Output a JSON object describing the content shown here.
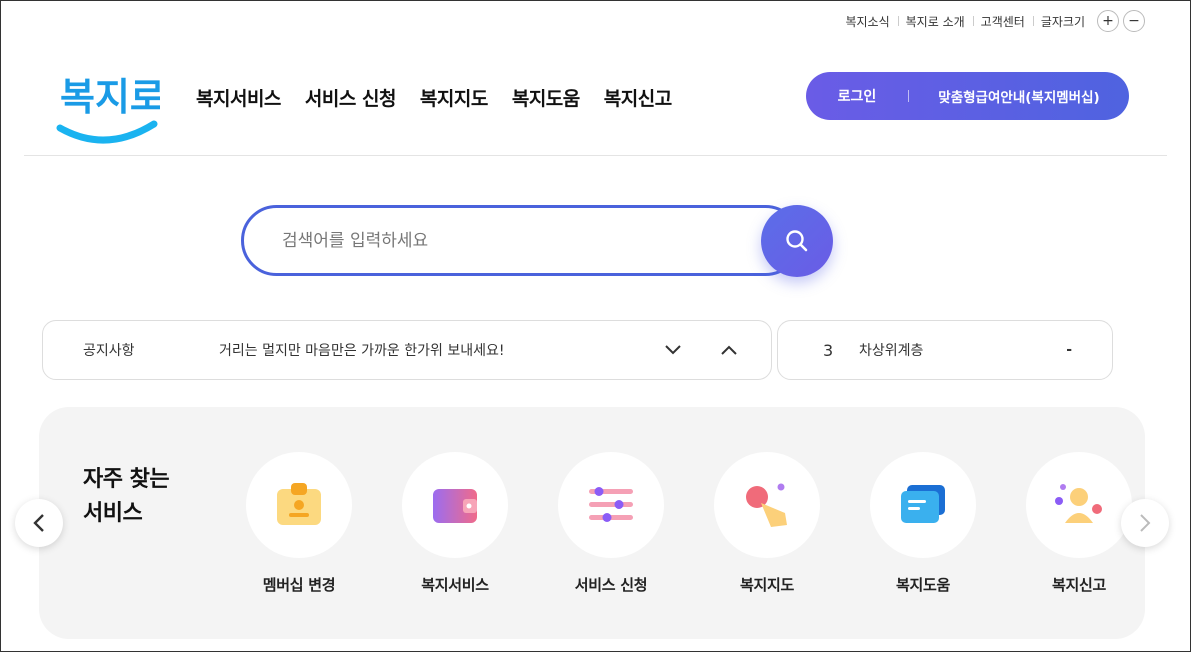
{
  "utility": {
    "links": [
      "복지소식",
      "복지로 소개",
      "고객센터",
      "글자크기"
    ],
    "font_plus": "+",
    "font_minus": "−"
  },
  "logo": {
    "text": "복지로"
  },
  "gnb": [
    "복지서비스",
    "서비스 신청",
    "복지지도",
    "복지도움",
    "복지신고"
  ],
  "auth": {
    "login": "로그인",
    "membership": "맞춤형급여안내(복지멤버십)"
  },
  "search": {
    "placeholder": "검색어를 입력하세요",
    "icon": "search-icon"
  },
  "notice": {
    "label": "공지사항",
    "text": "거리는 멀지만 마음만은 가까운 한가위 보내세요!"
  },
  "ranking": {
    "rank": "3",
    "keyword": "차상위계층",
    "change": "-"
  },
  "frequent": {
    "title_line1": "자주 찾는",
    "title_line2": "서비스",
    "items": [
      {
        "label": "멤버십 변경",
        "icon": "membership-card-icon"
      },
      {
        "label": "복지서비스",
        "icon": "wallet-icon"
      },
      {
        "label": "서비스 신청",
        "icon": "sliders-icon"
      },
      {
        "label": "복지지도",
        "icon": "map-pointer-icon"
      },
      {
        "label": "복지도움",
        "icon": "chat-icon"
      },
      {
        "label": "복지신고",
        "icon": "person-icon"
      }
    ]
  },
  "colors": {
    "accent": "#4a62dc",
    "accent2": "#6a5ce6",
    "logo_blue": "#1a9be6"
  }
}
